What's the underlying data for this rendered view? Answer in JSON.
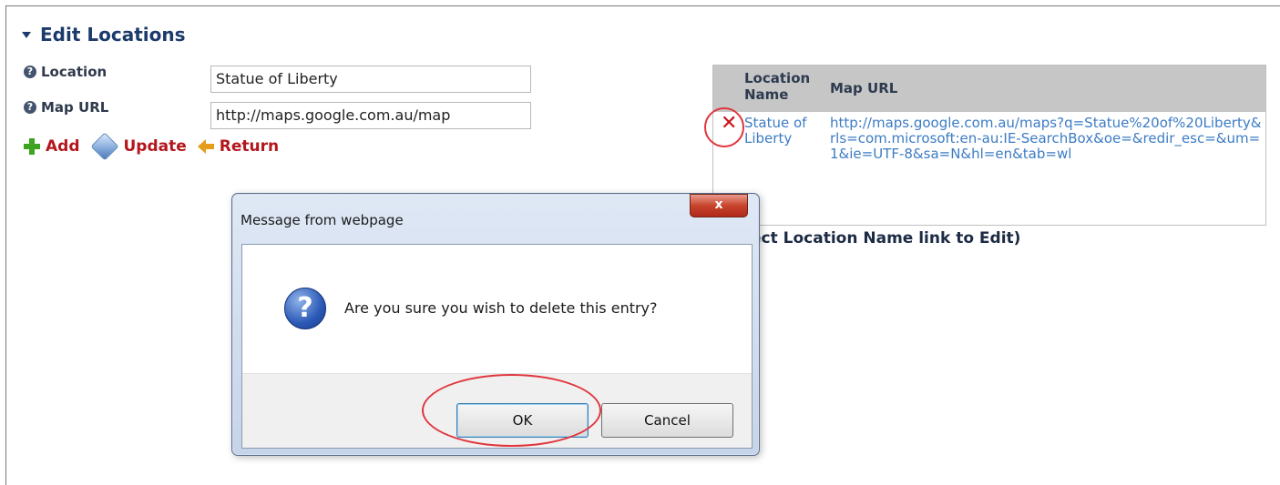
{
  "section": {
    "title": "Edit Locations"
  },
  "form": {
    "location_label": "Location",
    "location_value": "Statue of Liberty",
    "mapurl_label": "Map URL",
    "mapurl_value": "http://maps.google.com.au/map",
    "help_icon": "?"
  },
  "actions": {
    "add": "Add",
    "update": "Update",
    "return": "Return"
  },
  "table": {
    "columns": [
      "Location\nName",
      "Map URL"
    ],
    "col_name_line1": "Location",
    "col_name_line2": "Name",
    "col_url": "Map URL",
    "rows": [
      {
        "delete_icon": "✕",
        "name": "Statue of Liberty",
        "url": "http://maps.google.com.au/maps?q=Statue%20of%20Liberty&rls=com.microsoft:en-au:IE-SearchBox&oe=&redir_esc=&um=1&ie=UTF-8&sa=N&hl=en&tab=wl"
      }
    ],
    "hint": "ect Location Name link to Edit)"
  },
  "dialog": {
    "title": "Message from webpage",
    "close_label": "x",
    "icon": "?",
    "message": "Are you sure you wish to delete this entry?",
    "ok": "OK",
    "cancel": "Cancel"
  },
  "colors": {
    "action_red": "#b3161d",
    "link_blue": "#3c7cc4",
    "annotation_red": "#e0363d"
  }
}
